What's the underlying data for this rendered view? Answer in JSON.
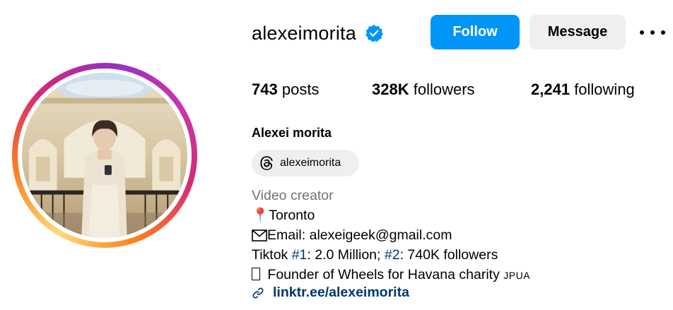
{
  "profile": {
    "username": "alexeimorita",
    "verified": true,
    "full_name": "Alexei morita"
  },
  "actions": {
    "follow_label": "Follow",
    "message_label": "Message",
    "more_icon": "more-horizontal-icon"
  },
  "stats": {
    "posts_count": "743",
    "posts_label": "posts",
    "followers_count": "328K",
    "followers_label": "followers",
    "following_count": "2,241",
    "following_label": "following"
  },
  "threads": {
    "icon": "threads-icon",
    "handle": "alexeimorita"
  },
  "bio": {
    "category": "Video creator",
    "location_pin": "📍",
    "location": "Toronto",
    "email_icon": "envelope-icon",
    "email": "Email: alexeigeek@gmail.com",
    "tiktok_prefix": "Tiktok ",
    "tag1": "#1",
    "tiktok_mid": ": 2.0 Million; ",
    "tag2": "#2",
    "tiktok_suffix": ": 740K followers",
    "founder_text": " Founder of Wheels for Havana charity",
    "founder_suffix": "JPUA",
    "link": "linktr.ee/alexeimorita"
  },
  "colors": {
    "follow_blue": "#0095f6",
    "link_navy": "#00376b",
    "category_gray": "#737373",
    "button_gray": "#efefef",
    "verified_blue": "#0095f6"
  }
}
